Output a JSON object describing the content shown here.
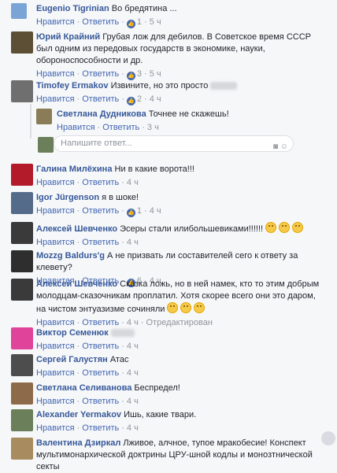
{
  "comments": [
    {
      "author": "Eugenio Tigrinian",
      "text": "Во бредятина ...",
      "like": "Нравится",
      "reply": "Ответить",
      "likes": "1",
      "time": "5 ч",
      "avatar": "#7aa4d6"
    },
    {
      "author": "Юрий Крайний",
      "text": "Грубая лож для дебилов. В Советское время СССР был одним из передовых государств в экономике, науки, обороноспособности и др.",
      "like": "Нравится",
      "reply": "Ответить",
      "likes": "3",
      "time": "5 ч",
      "avatar": "#5d4f35"
    },
    {
      "author": "Timofey Ermakov",
      "text": "Извините, но это просто",
      "like": "Нравится",
      "reply": "Ответить",
      "likes": "2",
      "time": "4 ч",
      "avatar": "#6f6f6f"
    },
    {
      "author": "Светлана Дудникова",
      "text": "Точнее не скажешь!",
      "like": "Нравится",
      "reply": "Ответить",
      "time": "3 ч",
      "avatar": "#8a7c56"
    },
    {
      "author": "Галина Милёхина",
      "text": "Ни в какие ворота!!!",
      "like": "Нравится",
      "reply": "Ответить",
      "time": "4 ч",
      "avatar": "#b31b2b"
    },
    {
      "author": "Igor Jürgenson",
      "text": "я в шоке!",
      "like": "Нравится",
      "reply": "Ответить",
      "likes": "1",
      "time": "4 ч",
      "avatar": "#556b8a"
    },
    {
      "author": "Алексей Шевченко",
      "text": "Эсеры стали илибольшевиками!!!!!!",
      "like": "Нравится",
      "reply": "Ответить",
      "time": "4 ч",
      "avatar": "#3a3a3a"
    },
    {
      "author": "Mozzg Baldurs'g",
      "text": "А не призвать ли составителей сего к ответу за клевету?",
      "like": "Нравится",
      "reply": "Ответить",
      "likes": "6",
      "time": "4 ч",
      "avatar": "#2e2e2e"
    },
    {
      "author": "Алексей Шевченко",
      "text": "Сказка ложь, но в ней намек, кто то этим добрым молодцам-сказочникам проплатил. Хотя скорее всего они это даром, на чистом энтуазизме сочиняли",
      "like": "Нравится",
      "reply": "Ответить",
      "time": "4 ч",
      "edited": "Отредактирован",
      "avatar": "#3a3a3a"
    },
    {
      "author": "Виктор Семенюк",
      "text": "",
      "like": "Нравится",
      "reply": "Ответить",
      "time": "4 ч",
      "avatar": "#e0439a"
    },
    {
      "author": "Сергей Галустян",
      "text": "Атас",
      "like": "Нравится",
      "reply": "Ответить",
      "time": "4 ч",
      "avatar": "#4d4d4d"
    },
    {
      "author": "Светлана Селиванова",
      "text": "Беспредел!",
      "like": "Нравится",
      "reply": "Ответить",
      "time": "4 ч",
      "avatar": "#8d6a4a"
    },
    {
      "author": "Alexander Yermakov",
      "text": "Ишь, какие твари.",
      "like": "Нравится",
      "reply": "Ответить",
      "time": "4 ч",
      "avatar": "#6b7f5a"
    },
    {
      "author": "Валентина Дзиркал",
      "text": "Лживое, алчное, тупое мракобесие! Конспект мультимонархической доктрины ЦРУ-шной кодлы и монозтнической секты",
      "avatar": "#a88b5e"
    }
  ],
  "reply_input": {
    "placeholder": "Напишите ответ..."
  },
  "icons": {
    "camera": "camera-icon",
    "sticker": "sticker-icon",
    "like": "like-thumb-icon"
  }
}
